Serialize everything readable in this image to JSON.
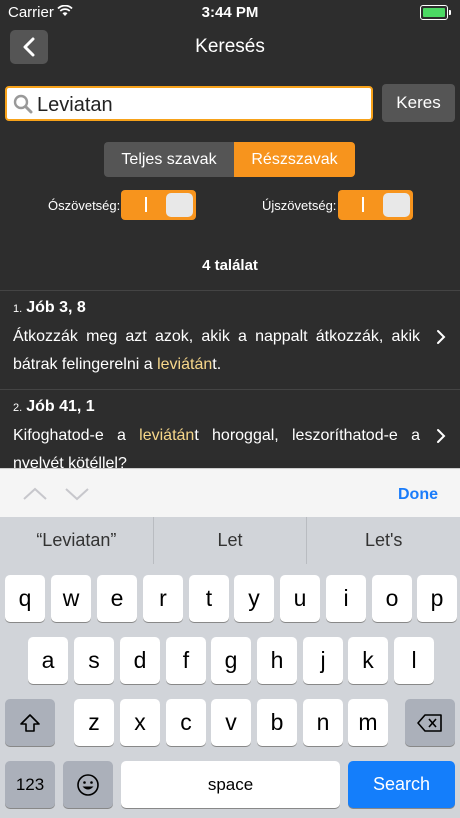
{
  "status": {
    "carrier": "Carrier",
    "time": "3:44 PM"
  },
  "nav": {
    "title": "Keresés"
  },
  "search": {
    "value": "Leviatan",
    "button_label": "Keres"
  },
  "segmented": {
    "options": [
      "Teljes szavak",
      "Részszavak"
    ],
    "selected": "Részszavak"
  },
  "toggles": {
    "old_label": "Ószövetség:",
    "old_value": "I",
    "new_label": "Újszövetség:",
    "new_value": "I"
  },
  "results": {
    "count": "4 találat",
    "items": [
      {
        "num": "1.",
        "ref": "Jób 3, 8",
        "before": "Átkozzák meg azt azok, akik a nappalt átkozzák, akik bátrak felingerelni a ",
        "match": "leviátán",
        "after": "t."
      },
      {
        "num": "2.",
        "ref": "Jób 41, 1",
        "before": "Kifoghatod-e a ",
        "match": "leviátán",
        "after": "t horoggal, leszoríthatod-e a nyelvét kötéllel?"
      }
    ]
  },
  "accessory": {
    "done": "Done"
  },
  "keyboard": {
    "suggestions": [
      "“Leviatan”",
      "Let",
      "Let's"
    ],
    "row1": [
      "q",
      "w",
      "e",
      "r",
      "t",
      "y",
      "u",
      "i",
      "o",
      "p"
    ],
    "row2": [
      "a",
      "s",
      "d",
      "f",
      "g",
      "h",
      "j",
      "k",
      "l"
    ],
    "row3": [
      "z",
      "x",
      "c",
      "v",
      "b",
      "n",
      "m"
    ],
    "numbers": "123",
    "space": "space",
    "search": "Search"
  },
  "colors": {
    "accent": "#f7941d",
    "highlight": "#f7d78a",
    "link": "#1a7cfa"
  }
}
